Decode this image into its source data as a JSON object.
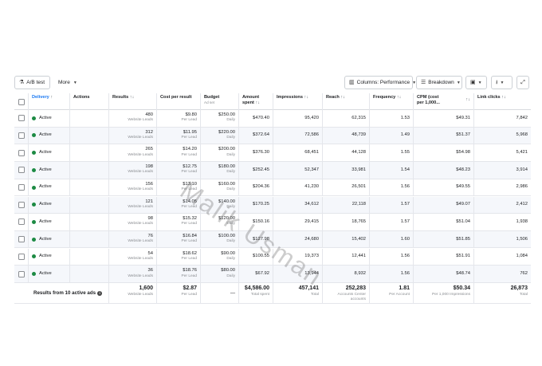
{
  "toolbar": {
    "ab_test_label": "A/B test",
    "more_label": "More",
    "columns_label": "Columns: Performance",
    "breakdown_label": "Breakdown"
  },
  "columns": {
    "delivery": "Delivery",
    "actions": "Actions",
    "results": "Results",
    "cost_per_result": "Cost per result",
    "budget": "Budget",
    "budget_sub": "Ad set",
    "amount_spent_1": "Amount",
    "amount_spent_2": "spent",
    "impressions": "Impressions",
    "reach": "Reach",
    "frequency": "Frequency",
    "cpm_1": "CPM (cost",
    "cpm_2": "per 1,000...",
    "link_clicks": "Link clicks",
    "sort_both": "↑↓",
    "sort_up": "↑"
  },
  "rows": [
    {
      "status": "Active",
      "results": "480",
      "results_sub": "Website Leads",
      "cpr": "$9.80",
      "cpr_sub": "Per Lead",
      "budget": "$250.00",
      "budget_sub": "Daily",
      "spent": "$470.40",
      "impressions": "95,420",
      "reach": "62,315",
      "frequency": "1.53",
      "cpm": "$49.31",
      "clicks": "7,842"
    },
    {
      "status": "Active",
      "results": "312",
      "results_sub": "Website Leads",
      "cpr": "$11.95",
      "cpr_sub": "Per Lead",
      "budget": "$220.00",
      "budget_sub": "Daily",
      "spent": "$372.64",
      "impressions": "72,586",
      "reach": "48,739",
      "frequency": "1.49",
      "cpm": "$51.37",
      "clicks": "5,968"
    },
    {
      "status": "Active",
      "results": "265",
      "results_sub": "Website Leads",
      "cpr": "$14.20",
      "cpr_sub": "Per Lead",
      "budget": "$200.00",
      "budget_sub": "Daily",
      "spent": "$376.30",
      "impressions": "68,451",
      "reach": "44,128",
      "frequency": "1.55",
      "cpm": "$54.98",
      "clicks": "5,421"
    },
    {
      "status": "Active",
      "results": "198",
      "results_sub": "Website Leads",
      "cpr": "$12.75",
      "cpr_sub": "Per Lead",
      "budget": "$180.00",
      "budget_sub": "Daily",
      "spent": "$252.45",
      "impressions": "52,347",
      "reach": "33,981",
      "frequency": "1.54",
      "cpm": "$48.23",
      "clicks": "3,914"
    },
    {
      "status": "Active",
      "results": "156",
      "results_sub": "Website Leads",
      "cpr": "$13.10",
      "cpr_sub": "Per Lead",
      "budget": "$160.00",
      "budget_sub": "Daily",
      "spent": "$204.36",
      "impressions": "41,230",
      "reach": "26,501",
      "frequency": "1.56",
      "cpm": "$49.55",
      "clicks": "2,986"
    },
    {
      "status": "Active",
      "results": "121",
      "results_sub": "Website Leads",
      "cpr": "$14.05",
      "cpr_sub": "Per Lead",
      "budget": "$140.00",
      "budget_sub": "Daily",
      "spent": "$170.25",
      "impressions": "34,612",
      "reach": "22,118",
      "frequency": "1.57",
      "cpm": "$49.07",
      "clicks": "2,412"
    },
    {
      "status": "Active",
      "results": "98",
      "results_sub": "Website Leads",
      "cpr": "$15.32",
      "cpr_sub": "Per Lead",
      "budget": "$120.00",
      "budget_sub": "Daily",
      "spent": "$150.16",
      "impressions": "29,415",
      "reach": "18,765",
      "frequency": "1.57",
      "cpm": "$51.04",
      "clicks": "1,938"
    },
    {
      "status": "Active",
      "results": "76",
      "results_sub": "Website Leads",
      "cpr": "$16.84",
      "cpr_sub": "Per Lead",
      "budget": "$100.00",
      "budget_sub": "Daily",
      "spent": "$127.98",
      "impressions": "24,680",
      "reach": "15,402",
      "frequency": "1.60",
      "cpm": "$51.85",
      "clicks": "1,506"
    },
    {
      "status": "Active",
      "results": "54",
      "results_sub": "Website Leads",
      "cpr": "$18.62",
      "cpr_sub": "Per Lead",
      "budget": "$90.00",
      "budget_sub": "Daily",
      "spent": "$100.55",
      "impressions": "19,373",
      "reach": "12,441",
      "frequency": "1.56",
      "cpm": "$51.91",
      "clicks": "1,084"
    },
    {
      "status": "Active",
      "results": "36",
      "results_sub": "Website Leads",
      "cpr": "$18.76",
      "cpr_sub": "Per Lead",
      "budget": "$80.00",
      "budget_sub": "Daily",
      "spent": "$67.92",
      "impressions": "13,944",
      "reach": "8,932",
      "frequency": "1.56",
      "cpm": "$48.74",
      "clicks": "762"
    }
  ],
  "summary": {
    "label": "Results from 10 active ads",
    "results": "1,600",
    "results_sub": "Website Leads",
    "cpr": "$2.87",
    "cpr_sub": "Per Lead",
    "budget": "—",
    "spent": "$4,586.00",
    "spent_sub": "Total spent",
    "impressions": "457,141",
    "impressions_sub": "Total",
    "reach": "252,283",
    "reach_sub": "Accounts Center accounts",
    "frequency": "1.81",
    "frequency_sub": "Per Account",
    "cpm": "$50.34",
    "cpm_sub": "Per 1,000 Impressions",
    "clicks": "26,873",
    "clicks_sub": "Total"
  },
  "watermark": "Malik Usman",
  "colors": {
    "active_dot": "#1c8a43",
    "delivery_header": "#1877f2"
  },
  "icons": [
    "flask-icon",
    "chevron-down-icon",
    "columns-icon",
    "breakdown-icon",
    "report-icon",
    "download-icon",
    "expand-icon",
    "sort-icon",
    "info-icon"
  ]
}
